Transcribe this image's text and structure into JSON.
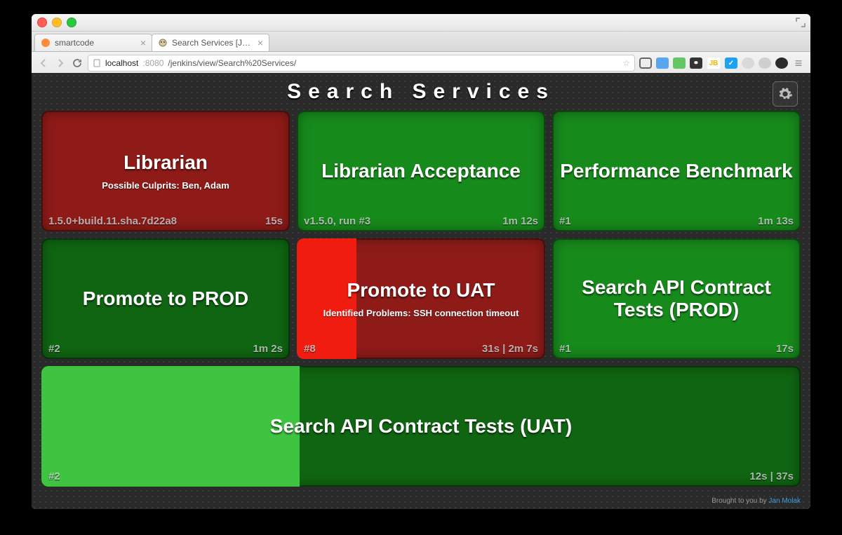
{
  "browser": {
    "tabs": [
      {
        "label": "smartcode"
      },
      {
        "label": "Search Services [Jenkins]"
      }
    ],
    "url": {
      "host": "localhost",
      "port": ":8080",
      "path": "/jenkins/view/Search%20Services/"
    },
    "ext": {
      "jb": "JB",
      "mask": "⚭",
      "check": "✓",
      "menu": "≡"
    }
  },
  "dashboard": {
    "title": "Search Services",
    "credit_prefix": "Brought to you by ",
    "credit_link": "Jan Molak"
  },
  "widgets": {
    "librarian": {
      "title": "Librarian",
      "sub": "Possible Culprits: Ben,  Adam",
      "left": "1.5.0+build.11.sha.7d22a8",
      "right": "15s"
    },
    "librarian_acc": {
      "title": "Librarian Acceptance",
      "left": "v1.5.0, run #3",
      "right": "1m 12s"
    },
    "perf": {
      "title": "Performance Benchmark",
      "left": "#1",
      "right": "1m 13s"
    },
    "prod": {
      "title": "Promote to PROD",
      "left": "#2",
      "right": "1m 2s"
    },
    "uat": {
      "title": "Promote to UAT",
      "sub": "Identified Problems: SSH connection timeout",
      "left": "#8",
      "right": "31s | 2m 7s"
    },
    "search_prod": {
      "title": "Search API Contract Tests (PROD)",
      "left": "#1",
      "right": "17s"
    },
    "search_uat": {
      "title": "Search API Contract Tests (UAT)",
      "left": "#2",
      "right": "12s | 37s"
    }
  }
}
